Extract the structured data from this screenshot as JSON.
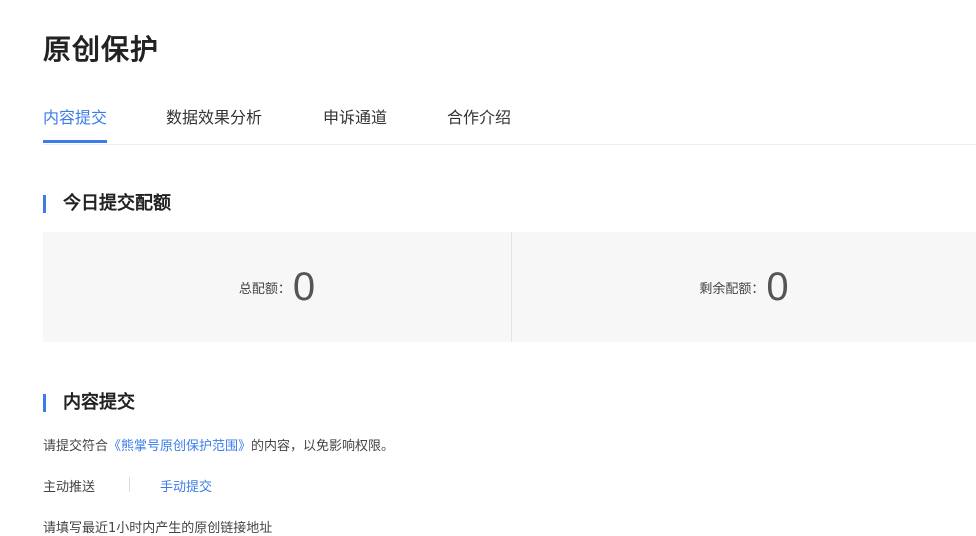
{
  "page": {
    "title": "原创保护"
  },
  "tabs": [
    {
      "label": "内容提交",
      "active": true
    },
    {
      "label": "数据效果分析",
      "active": false
    },
    {
      "label": "申诉通道",
      "active": false
    },
    {
      "label": "合作介绍",
      "active": false
    }
  ],
  "quota_section": {
    "title": "今日提交配额",
    "total_label": "总配额：",
    "total_value": "0",
    "remaining_label": "剩余配额：",
    "remaining_value": "0"
  },
  "submit_section": {
    "title": "内容提交",
    "desc_prefix": "请提交符合",
    "desc_link": "《熊掌号原创保护范围》",
    "desc_suffix": "的内容，以免影响权限。",
    "subtabs": [
      {
        "label": "主动推送",
        "active": true
      },
      {
        "label": "手动提交",
        "active": false
      }
    ],
    "hint": "请填写最近1小时内产生的原创链接地址"
  },
  "colors": {
    "accent": "#3b7de8",
    "panel_bg": "#f7f7f7",
    "text": "#333333"
  }
}
